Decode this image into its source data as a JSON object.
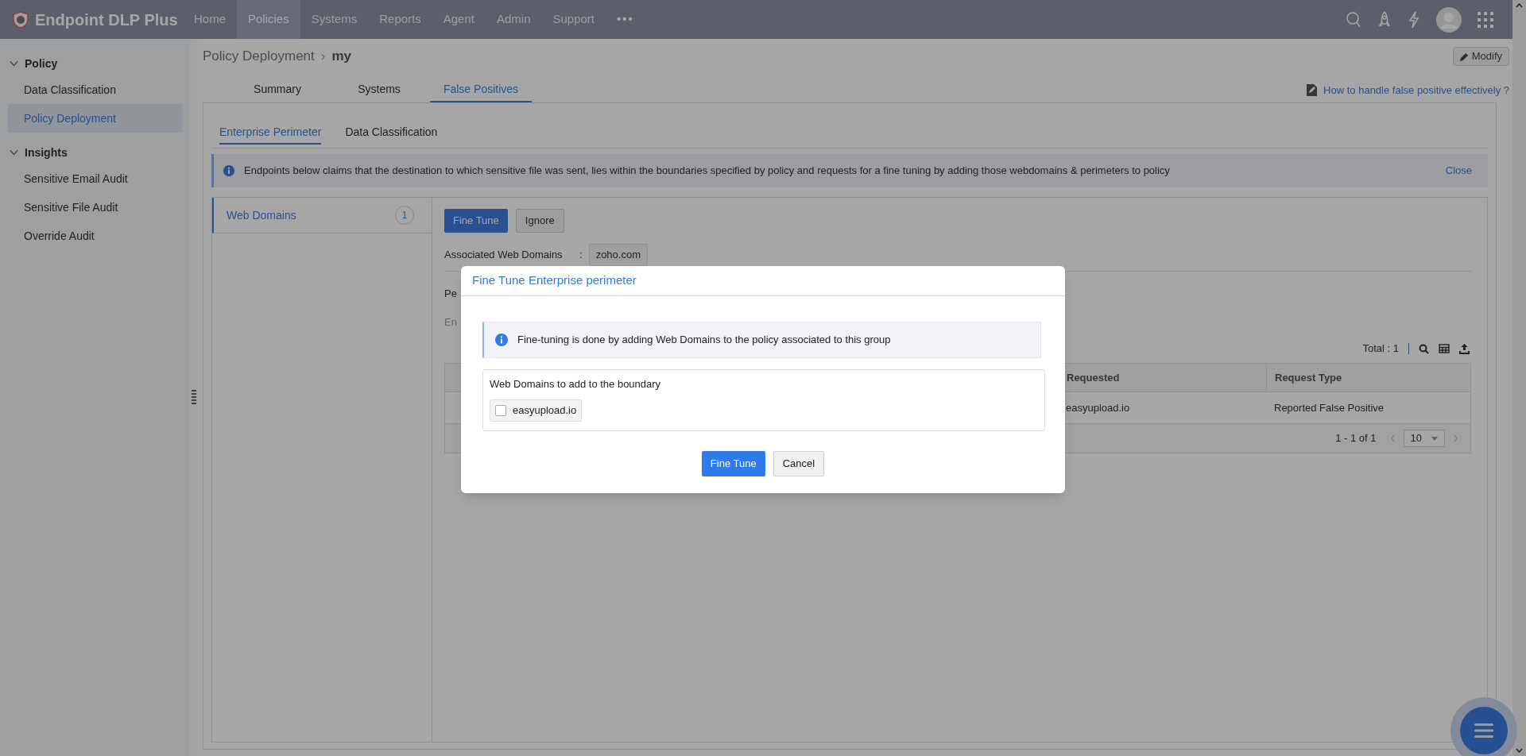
{
  "app": {
    "name": "Endpoint DLP Plus"
  },
  "nav": [
    {
      "label": "Home",
      "selected": false
    },
    {
      "label": "Policies",
      "selected": true
    },
    {
      "label": "Systems",
      "selected": false
    },
    {
      "label": "Reports",
      "selected": false
    },
    {
      "label": "Agent",
      "selected": false
    },
    {
      "label": "Admin",
      "selected": false
    },
    {
      "label": "Support",
      "selected": false
    }
  ],
  "nav_more": "•••",
  "sidebar": [
    {
      "title": "Policy",
      "expanded": true,
      "items": [
        {
          "label": "Data Classification",
          "selected": false
        },
        {
          "label": "Policy Deployment",
          "selected": true
        }
      ]
    },
    {
      "title": "Insights",
      "expanded": true,
      "items": [
        {
          "label": "Sensitive Email Audit",
          "selected": false
        },
        {
          "label": "Sensitive File Audit",
          "selected": false
        },
        {
          "label": "Override Audit",
          "selected": false
        }
      ]
    }
  ],
  "breadcrumb": {
    "parent": "Policy Deployment",
    "separator": "›",
    "current": "my"
  },
  "modify_button": "Modify",
  "tabs": [
    {
      "label": "Summary",
      "selected": false
    },
    {
      "label": "Systems",
      "selected": false
    },
    {
      "label": "False Positives",
      "selected": true
    }
  ],
  "help_link": "How to handle false positive effectively ?",
  "subtabs": [
    {
      "label": "Enterprise Perimeter",
      "selected": true
    },
    {
      "label": "Data Classification",
      "selected": false
    }
  ],
  "banner": {
    "text": "Endpoints below claims that the destination to which sensitive file was sent, lies within the boundaries specified by policy and requests for a fine tuning by adding those webdomains & perimeters to policy",
    "close": "Close"
  },
  "categories": [
    {
      "label": "Web Domains",
      "count": "1",
      "selected": true
    }
  ],
  "actions": [
    {
      "label": "Fine Tune",
      "kind": "primary"
    },
    {
      "label": "Ignore",
      "kind": "secondary"
    }
  ],
  "associated": {
    "label": "Associated Web Domains",
    "separator": ":",
    "values": [
      "zoho.com"
    ]
  },
  "cut_texts": [
    "Pe",
    "En"
  ],
  "table": {
    "total": "Total : 1",
    "columns": [
      "Requested",
      "Request Type"
    ],
    "rows": [
      [
        "easyupload.io",
        "Reported False Positive"
      ]
    ],
    "range": "1 - 1 of 1",
    "page_size": "10"
  },
  "dialog": {
    "title": "Fine Tune Enterprise perimeter",
    "info": "Fine-tuning is done by adding Web Domains to the policy associated to this group",
    "list_title": "Web Domains to add to the boundary",
    "domains": [
      {
        "label": "easyupload.io",
        "checked": false
      }
    ],
    "buttons": [
      {
        "label": "Fine Tune",
        "kind": "primary"
      },
      {
        "label": "Cancel",
        "kind": "secondary"
      }
    ]
  }
}
